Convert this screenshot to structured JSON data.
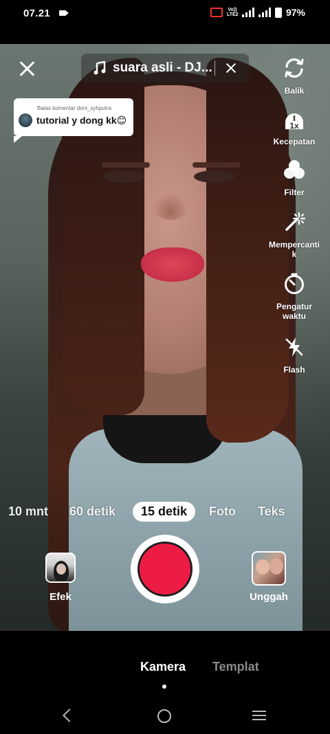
{
  "status_bar": {
    "time": "07.21",
    "network_label": "Vo)) LTE2",
    "battery": "97%"
  },
  "top_bar": {
    "sound_label": "suara asli - DJ...",
    "close_icon": "close-icon",
    "sound_remove_icon": "close-icon"
  },
  "reply_sticker": {
    "meta": "Balas komentar doni_syhputra",
    "text": "tutorial y dong kk😊"
  },
  "tools": [
    {
      "label": "Balik",
      "icon": "flip-camera-icon"
    },
    {
      "label": "Kecepatan",
      "icon": "speed-icon",
      "badge": "1x"
    },
    {
      "label": "Filter",
      "icon": "filter-icon"
    },
    {
      "label": "Mempercanti\nk",
      "icon": "beauty-wand-icon"
    },
    {
      "label": "Pengatur\nwaktu",
      "icon": "timer-icon"
    },
    {
      "label": "Flash",
      "icon": "flash-off-icon"
    }
  ],
  "modes": {
    "items": [
      "10 mnt",
      "60 detik",
      "15 detik",
      "Foto",
      "Teks"
    ],
    "selected": "15 detik"
  },
  "capture": {
    "effect_label": "Efek",
    "upload_label": "Unggah"
  },
  "bottom_tabs": {
    "camera": "Kamera",
    "template": "Templat",
    "active": "Kamera"
  },
  "colors": {
    "record": "#ec1c45",
    "accent_white": "#ffffff"
  }
}
